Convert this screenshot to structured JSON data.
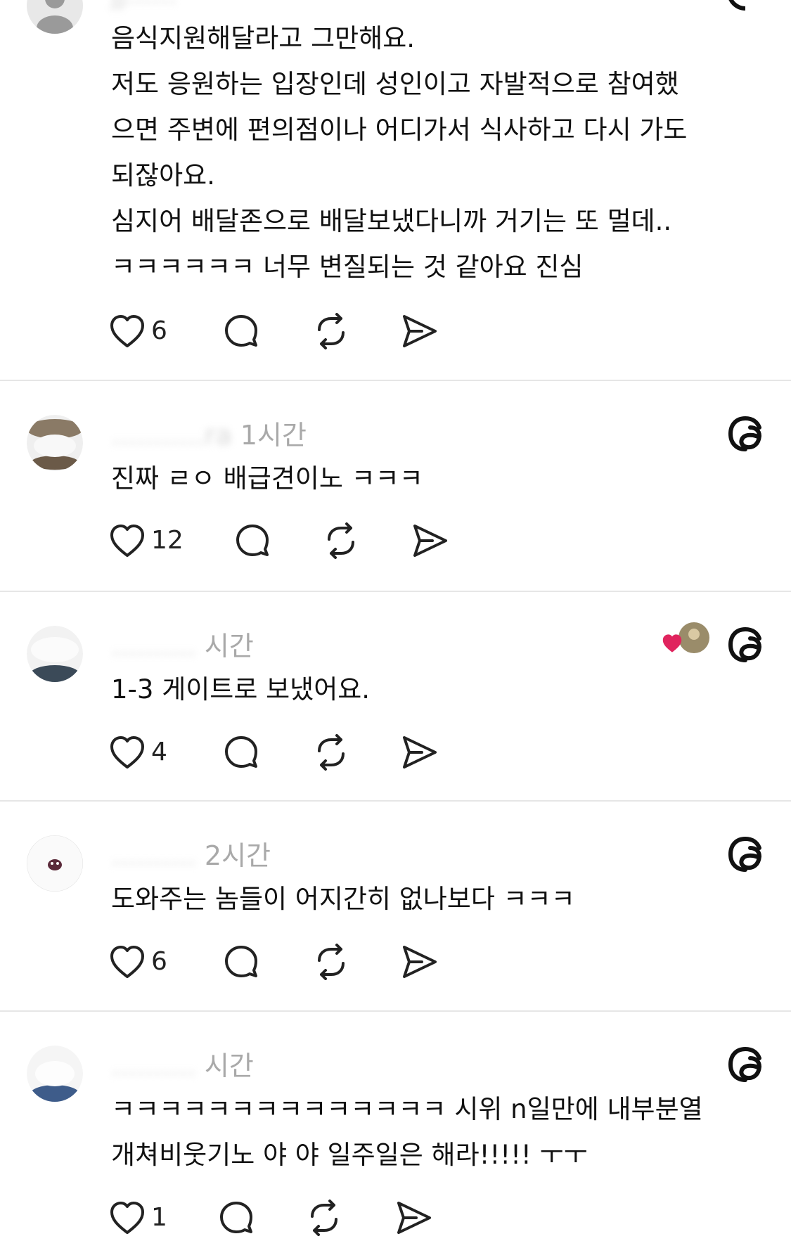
{
  "posts": [
    {
      "username": "jj......",
      "time": "",
      "lines": [
        "음식지원해달라고 그만해요.",
        "저도 응원하는 입장인데 성인이고 자발적으로 참여했",
        "으면 주변에 편의점이나 어디가서 식사하고 다시 가도",
        "되잖아요.",
        "심지어 배달존으로 배달보냈다니까 거기는 또 멀데..",
        "ㅋㅋㅋㅋㅋㅋ 너무 변질되는 것 같아요 진심"
      ],
      "likes": "6"
    },
    {
      "username": "...........ra",
      "time": "1시간",
      "lines": [
        "진짜 ㄹㅇ 배급견이노 ㅋㅋㅋ"
      ],
      "likes": "12"
    },
    {
      "username": "..........",
      "time": "시간",
      "lines": [
        "1-3 게이트로 보냈어요."
      ],
      "likes": "4"
    },
    {
      "username": "..........",
      "time": "2시간",
      "lines": [
        "도와주는 놈들이 어지간히 없나보다 ㅋㅋㅋ"
      ],
      "likes": "6"
    },
    {
      "username": "..........",
      "time": "시간",
      "lines": [
        "ㅋㅋㅋㅋㅋㅋㅋㅋㅋㅋㅋㅋㅋㅋ 시위 n일만에 내부분열",
        "개쳐비웃기노 야 야 일주일은 해라!!!!! ㅜㅜ"
      ],
      "likes": "1"
    }
  ],
  "icons": {
    "like": "heart-icon",
    "reply": "comment-icon",
    "repost": "repost-icon",
    "share": "share-icon",
    "app": "threads-icon"
  },
  "colors": {
    "like_heart": "#e0245e",
    "divider": "#e6e6e6"
  }
}
